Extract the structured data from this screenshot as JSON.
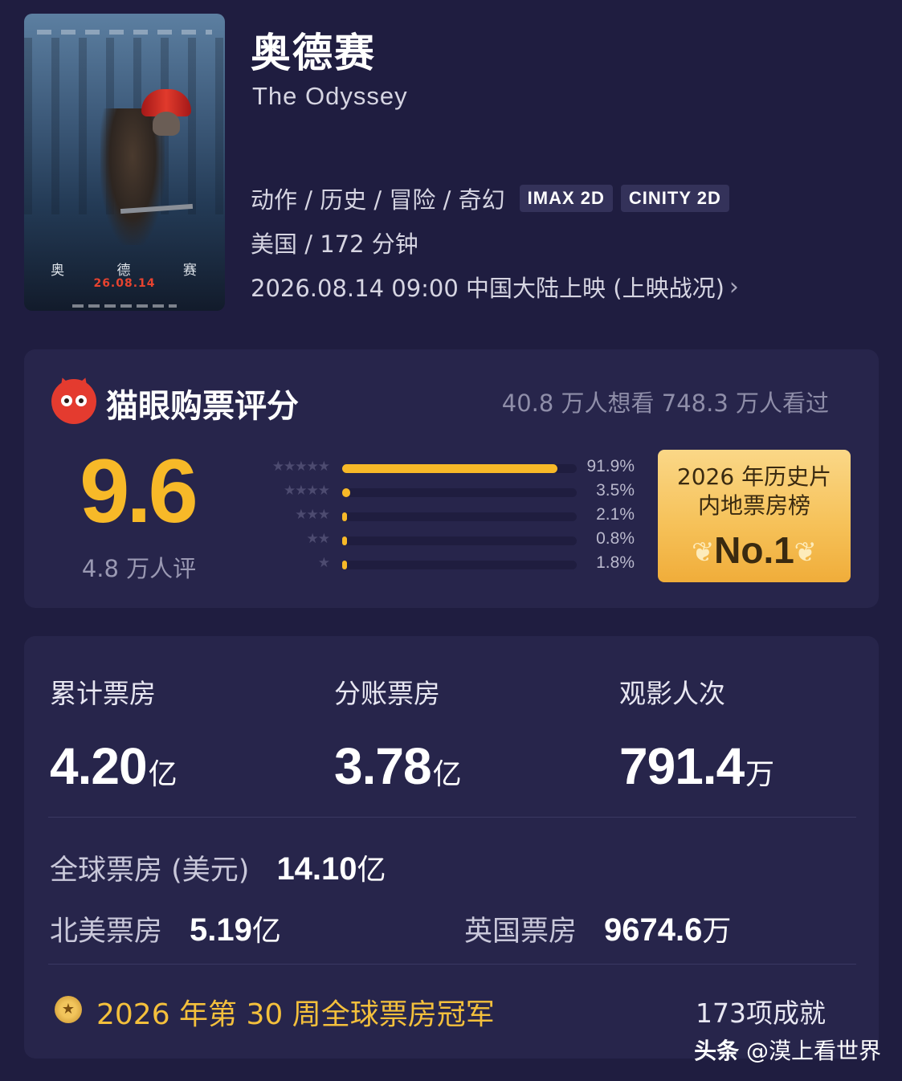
{
  "movie": {
    "title_cn": "奥德赛",
    "title_en": "The Odyssey",
    "genres": "动作 / 历史 / 冒险 / 奇幻",
    "formats": [
      "IMAX 2D",
      "CINITY 2D"
    ],
    "country_duration": "美国 / 172 分钟",
    "release": "2026.08.14 09:00 中国大陆上映 (上映战况)",
    "poster": {
      "title": "奥 德 赛",
      "date": "26.08.14"
    }
  },
  "rating": {
    "title": "猫眼购票评分",
    "wants": "40.8 万人想看 748.3 万人看过",
    "score": "9.6",
    "count": "4.8 万人评",
    "distribution": [
      {
        "stars": 5,
        "label": "★★★★★",
        "percent": 91.9,
        "text": "91.9%"
      },
      {
        "stars": 4,
        "label": "★★★★",
        "percent": 3.5,
        "text": "3.5%"
      },
      {
        "stars": 3,
        "label": "★★★",
        "percent": 2.1,
        "text": "2.1%"
      },
      {
        "stars": 2,
        "label": "★★",
        "percent": 0.8,
        "text": "0.8%"
      },
      {
        "stars": 1,
        "label": "★",
        "percent": 1.8,
        "text": "1.8%"
      }
    ],
    "rank_badge": {
      "line1": "2026 年历史片",
      "line2": "内地票房榜",
      "rank": "No.1"
    }
  },
  "box_office": {
    "stats": [
      {
        "label": "累计票房",
        "value": "4.20",
        "unit": "亿"
      },
      {
        "label": "分账票房",
        "value": "3.78",
        "unit": "亿"
      },
      {
        "label": "观影人次",
        "value": "791.4",
        "unit": "万"
      }
    ],
    "global": {
      "label": "全球票房 (美元)",
      "value": "14.10",
      "unit": "亿"
    },
    "north_america": {
      "label": "北美票房",
      "value": "5.19",
      "unit": "亿"
    },
    "uk": {
      "label": "英国票房",
      "value": "9674.6",
      "unit": "万"
    },
    "achievement": {
      "text": "2026 年第 30 周全球票房冠军",
      "count": "173项成就"
    }
  },
  "watermark": {
    "prefix": "头条",
    "handle": "@漠上看世界"
  },
  "colors": {
    "background": "#1f1d40",
    "card": "#27254b",
    "accent": "#f7b928",
    "brand_red": "#e43b2f"
  }
}
